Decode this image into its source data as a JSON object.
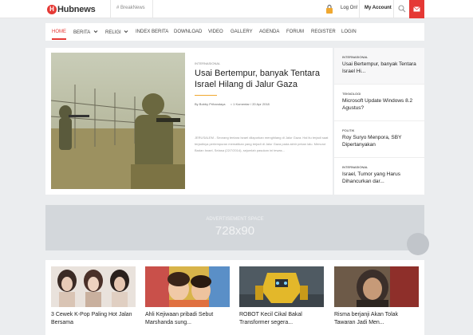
{
  "header": {
    "logo_mark": "H",
    "logo_text": "Hubnews",
    "breaknews": "# BreakNews",
    "login": "Log On!",
    "my_account": "My Account"
  },
  "nav": {
    "items": [
      "HOME",
      "BERITA",
      "RELIGI",
      "INDEX BERITA",
      "DOWNLOAD",
      "VIDEO",
      "GALLERY",
      "AGENDA",
      "FORUM",
      "REGISTER",
      "LOGIN"
    ],
    "active": "HOME"
  },
  "featured": {
    "category": "INTERNASIONAL",
    "title": "Usai Bertempur, banyak Tentara Israel Hilang di Jalur Gaza",
    "author": "By Bobby Prihandaya",
    "comments": "1 Komentar",
    "date": "20 Apr 2018",
    "excerpt": "JERUSALEM - Seorang tentara Israel dilaporkan menghilang di Jalur Gaza. Hal itu terjadi saat terjadinya pertempuran mematikan yang terjadi di Jalur Gaza pada akhir pekan lalu. Menurut Badan Israel, Selasa (22/7/2014), sejumlah pasukan ini tewas..."
  },
  "sidebar": {
    "items": [
      {
        "category": "INTERNASIONAL",
        "title": "Usai Bertempur, banyak Tentara Israel Hi..."
      },
      {
        "category": "TEKNOLOGI",
        "title": "Microsoft Update Windows 8.2 Agustus?"
      },
      {
        "category": "POLITIK",
        "title": "Roy Suryo Menpora, SBY Dipertanyakan"
      },
      {
        "category": "INTERNASIONAL",
        "title": "Israel, Tumor yang Harus Dihancurkan dar..."
      }
    ]
  },
  "ad": {
    "label": "ADVERTISEMENT SPACE",
    "size": "728x90"
  },
  "cards": [
    {
      "title": "3 Cewek K-Pop Paling Hot Jalan Bersama"
    },
    {
      "title": "Ahli Kejiwaan pribadi Sebut Marshanda sung..."
    },
    {
      "title": "ROBOT Kecil Cikal Bakal Transformer segera..."
    },
    {
      "title": "Risma berjanji Akan Tolak Tawaran Jadi Men..."
    }
  ],
  "colors": {
    "accent": "#e53935",
    "rule": "#f0a830"
  }
}
